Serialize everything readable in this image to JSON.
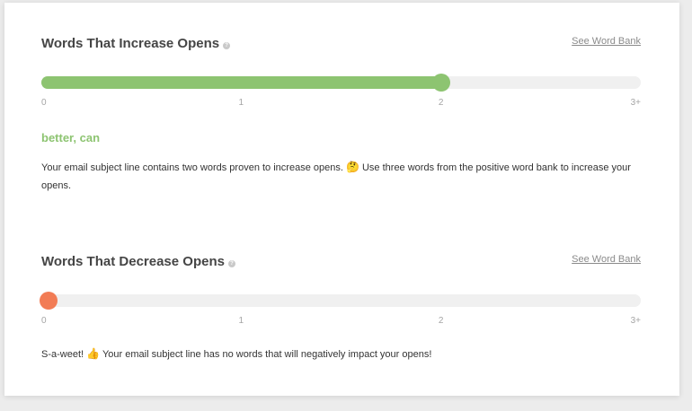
{
  "colors": {
    "positive": "#8dc471",
    "negative": "#f27c55",
    "track": "#f0f0f0"
  },
  "increase": {
    "title": "Words That Increase Opens",
    "help_icon": "question-icon",
    "link": "See Word Bank",
    "value": 2,
    "max": 3,
    "ticks": [
      "0",
      "1",
      "2",
      "3+"
    ],
    "words": "better, can",
    "desc_before": "Your email subject line contains two words proven to increase opens.",
    "emoji": "🤔",
    "emoji_name": "thinking-face-icon",
    "desc_after": "Use three words from the positive word bank to increase your opens."
  },
  "decrease": {
    "title": "Words That Decrease Opens",
    "help_icon": "question-icon",
    "link": "See Word Bank",
    "value": 0,
    "max": 3,
    "ticks": [
      "0",
      "1",
      "2",
      "3+"
    ],
    "desc_before": "S-a-weet!",
    "emoji": "👍",
    "emoji_name": "thumbs-up-icon",
    "desc_after": "Your email subject line has no words that will negatively impact your opens!"
  }
}
